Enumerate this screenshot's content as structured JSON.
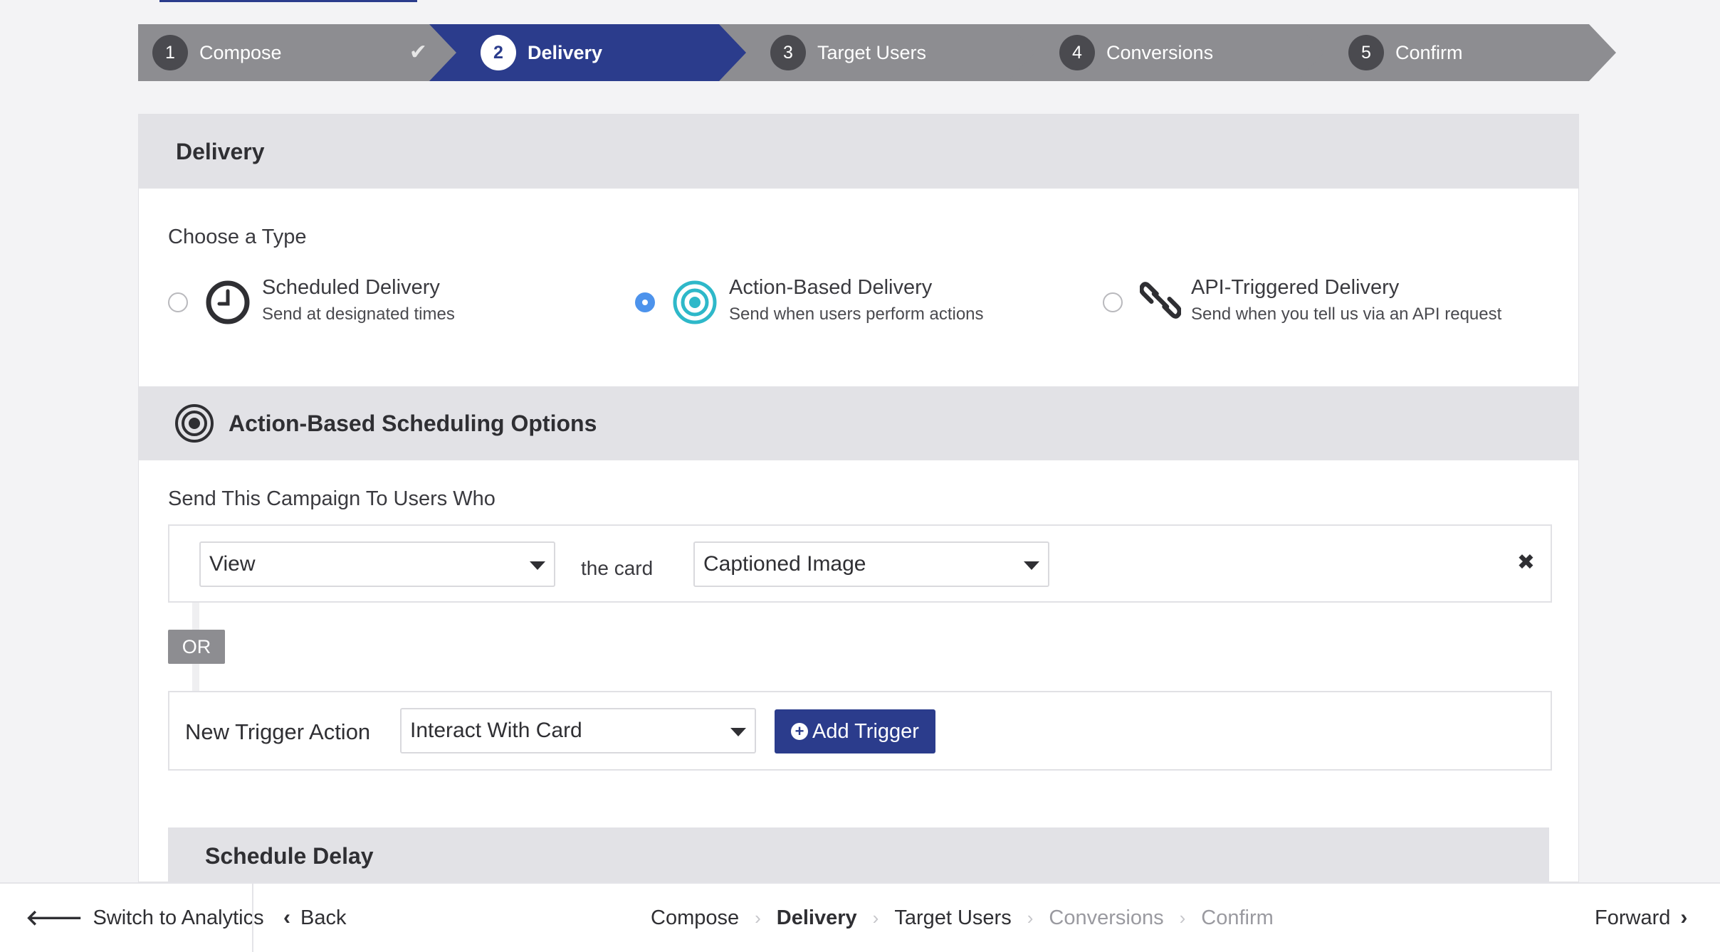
{
  "stepper": {
    "steps": [
      {
        "num": "1",
        "label": "Compose",
        "state": "completed"
      },
      {
        "num": "2",
        "label": "Delivery",
        "state": "active"
      },
      {
        "num": "3",
        "label": "Target Users",
        "state": "pending"
      },
      {
        "num": "4",
        "label": "Conversions",
        "state": "pending"
      },
      {
        "num": "5",
        "label": "Confirm",
        "state": "pending"
      }
    ],
    "check_icon": "check-icon"
  },
  "delivery": {
    "title": "Delivery",
    "choose_label": "Choose a Type",
    "types": [
      {
        "title": "Scheduled Delivery",
        "subtitle": "Send at designated times",
        "icon": "clock-icon",
        "selected": false
      },
      {
        "title": "Action-Based Delivery",
        "subtitle": "Send when users perform actions",
        "icon": "target-icon",
        "selected": true
      },
      {
        "title": "API-Triggered Delivery",
        "subtitle": "Send when you tell us via an API request",
        "icon": "link-icon",
        "selected": false
      }
    ]
  },
  "action_options": {
    "title": "Action-Based Scheduling Options",
    "send_label": "Send This Campaign To Users Who",
    "trigger": {
      "action_value": "View",
      "connector": "the card",
      "card_value": "Captioned Image",
      "remove_icon": "close-icon"
    },
    "or_label": "OR",
    "new_trigger": {
      "label": "New Trigger Action",
      "value": "Interact With Card",
      "button": "Add Trigger"
    },
    "schedule_delay": "Schedule Delay"
  },
  "footer": {
    "switch_label": "Switch to Analytics",
    "back_label": "Back",
    "forward_label": "Forward",
    "crumbs": [
      {
        "label": "Compose",
        "state": "normal"
      },
      {
        "label": "Delivery",
        "state": "active"
      },
      {
        "label": "Target Users",
        "state": "normal"
      },
      {
        "label": "Conversions",
        "state": "disabled"
      },
      {
        "label": "Confirm",
        "state": "disabled"
      }
    ]
  },
  "colors": {
    "primary": "#2b3c8c",
    "step_inactive": "#8d8d91",
    "radio_selected": "#4d93ec",
    "target_icon": "#2eb8c9"
  }
}
